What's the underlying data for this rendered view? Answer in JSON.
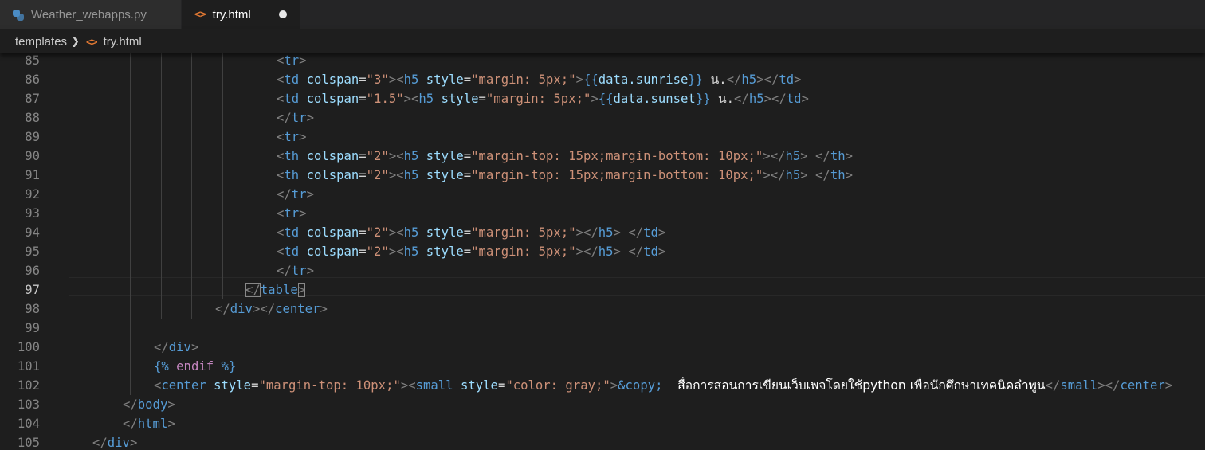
{
  "tabs": [
    {
      "label": "Weather_webapps.py",
      "icon": "python-file-icon",
      "active": false
    },
    {
      "label": "try.html",
      "icon": "html-file-icon",
      "active": true,
      "unsaved": true
    }
  ],
  "breadcrumb": {
    "folder": "templates",
    "separator_icon": "chevron-right-icon",
    "file": "try.html"
  },
  "editor": {
    "colors": {
      "background": "#1e1e1e",
      "tag": "#569cd6",
      "punctuation": "#808080",
      "attribute": "#9cdcfe",
      "string": "#ce9178",
      "template": "#c586c0",
      "text": "#d4d4d4"
    },
    "cursor_line": "97",
    "lines": [
      {
        "num": "85",
        "indent": 7,
        "tokens": [
          [
            "pun",
            "<"
          ],
          [
            "tag",
            "tr"
          ],
          [
            "pun",
            ">"
          ]
        ]
      },
      {
        "num": "86",
        "indent": 7,
        "tokens": [
          [
            "pun",
            "<"
          ],
          [
            "tag",
            "td"
          ],
          [
            "plain",
            " "
          ],
          [
            "attr",
            "colspan"
          ],
          [
            "plain",
            "="
          ],
          [
            "str",
            "\"3\""
          ],
          [
            "pun",
            ">"
          ],
          [
            "pun",
            "<"
          ],
          [
            "tag",
            "h5"
          ],
          [
            "plain",
            " "
          ],
          [
            "attr",
            "style"
          ],
          [
            "plain",
            "="
          ],
          [
            "str",
            "\"margin: 5px;\""
          ],
          [
            "pun",
            ">"
          ],
          [
            "tag",
            "{{"
          ],
          [
            "attr",
            "data.sunrise"
          ],
          [
            "tag",
            "}}"
          ],
          [
            "plain",
            " น."
          ],
          [
            "pun",
            "</"
          ],
          [
            "tag",
            "h5"
          ],
          [
            "pun",
            ">"
          ],
          [
            "pun",
            "</"
          ],
          [
            "tag",
            "td"
          ],
          [
            "pun",
            ">"
          ]
        ]
      },
      {
        "num": "87",
        "indent": 7,
        "tokens": [
          [
            "pun",
            "<"
          ],
          [
            "tag",
            "td"
          ],
          [
            "plain",
            " "
          ],
          [
            "attr",
            "colspan"
          ],
          [
            "plain",
            "="
          ],
          [
            "str",
            "\"1.5\""
          ],
          [
            "pun",
            ">"
          ],
          [
            "pun",
            "<"
          ],
          [
            "tag",
            "h5"
          ],
          [
            "plain",
            " "
          ],
          [
            "attr",
            "style"
          ],
          [
            "plain",
            "="
          ],
          [
            "str",
            "\"margin: 5px;\""
          ],
          [
            "pun",
            ">"
          ],
          [
            "tag",
            "{{"
          ],
          [
            "attr",
            "data.sunset"
          ],
          [
            "tag",
            "}}"
          ],
          [
            "plain",
            " น."
          ],
          [
            "pun",
            "</"
          ],
          [
            "tag",
            "h5"
          ],
          [
            "pun",
            ">"
          ],
          [
            "pun",
            "</"
          ],
          [
            "tag",
            "td"
          ],
          [
            "pun",
            ">"
          ]
        ]
      },
      {
        "num": "88",
        "indent": 7,
        "tokens": [
          [
            "pun",
            "</"
          ],
          [
            "tag",
            "tr"
          ],
          [
            "pun",
            ">"
          ]
        ]
      },
      {
        "num": "89",
        "indent": 7,
        "tokens": [
          [
            "pun",
            "<"
          ],
          [
            "tag",
            "tr"
          ],
          [
            "pun",
            ">"
          ]
        ]
      },
      {
        "num": "90",
        "indent": 7,
        "tokens": [
          [
            "pun",
            "<"
          ],
          [
            "tag",
            "th"
          ],
          [
            "plain",
            " "
          ],
          [
            "attr",
            "colspan"
          ],
          [
            "plain",
            "="
          ],
          [
            "str",
            "\"2\""
          ],
          [
            "pun",
            ">"
          ],
          [
            "pun",
            "<"
          ],
          [
            "tag",
            "h5"
          ],
          [
            "plain",
            " "
          ],
          [
            "attr",
            "style"
          ],
          [
            "plain",
            "="
          ],
          [
            "str",
            "\"margin-top: 15px;margin-bottom: 10px;\""
          ],
          [
            "pun",
            ">"
          ],
          [
            "pun",
            "</"
          ],
          [
            "tag",
            "h5"
          ],
          [
            "pun",
            ">"
          ],
          [
            "plain",
            " "
          ],
          [
            "pun",
            "</"
          ],
          [
            "tag",
            "th"
          ],
          [
            "pun",
            ">"
          ]
        ]
      },
      {
        "num": "91",
        "indent": 7,
        "tokens": [
          [
            "pun",
            "<"
          ],
          [
            "tag",
            "th"
          ],
          [
            "plain",
            " "
          ],
          [
            "attr",
            "colspan"
          ],
          [
            "plain",
            "="
          ],
          [
            "str",
            "\"2\""
          ],
          [
            "pun",
            ">"
          ],
          [
            "pun",
            "<"
          ],
          [
            "tag",
            "h5"
          ],
          [
            "plain",
            " "
          ],
          [
            "attr",
            "style"
          ],
          [
            "plain",
            "="
          ],
          [
            "str",
            "\"margin-top: 15px;margin-bottom: 10px;\""
          ],
          [
            "pun",
            ">"
          ],
          [
            "pun",
            "</"
          ],
          [
            "tag",
            "h5"
          ],
          [
            "pun",
            ">"
          ],
          [
            "plain",
            " "
          ],
          [
            "pun",
            "</"
          ],
          [
            "tag",
            "th"
          ],
          [
            "pun",
            ">"
          ]
        ]
      },
      {
        "num": "92",
        "indent": 7,
        "tokens": [
          [
            "pun",
            "</"
          ],
          [
            "tag",
            "tr"
          ],
          [
            "pun",
            ">"
          ]
        ]
      },
      {
        "num": "93",
        "indent": 7,
        "tokens": [
          [
            "pun",
            "<"
          ],
          [
            "tag",
            "tr"
          ],
          [
            "pun",
            ">"
          ]
        ]
      },
      {
        "num": "94",
        "indent": 7,
        "tokens": [
          [
            "pun",
            "<"
          ],
          [
            "tag",
            "td"
          ],
          [
            "plain",
            " "
          ],
          [
            "attr",
            "colspan"
          ],
          [
            "plain",
            "="
          ],
          [
            "str",
            "\"2\""
          ],
          [
            "pun",
            ">"
          ],
          [
            "pun",
            "<"
          ],
          [
            "tag",
            "h5"
          ],
          [
            "plain",
            " "
          ],
          [
            "attr",
            "style"
          ],
          [
            "plain",
            "="
          ],
          [
            "str",
            "\"margin: 5px;\""
          ],
          [
            "pun",
            ">"
          ],
          [
            "pun",
            "</"
          ],
          [
            "tag",
            "h5"
          ],
          [
            "pun",
            ">"
          ],
          [
            "plain",
            " "
          ],
          [
            "pun",
            "</"
          ],
          [
            "tag",
            "td"
          ],
          [
            "pun",
            ">"
          ]
        ]
      },
      {
        "num": "95",
        "indent": 7,
        "tokens": [
          [
            "pun",
            "<"
          ],
          [
            "tag",
            "td"
          ],
          [
            "plain",
            " "
          ],
          [
            "attr",
            "colspan"
          ],
          [
            "plain",
            "="
          ],
          [
            "str",
            "\"2\""
          ],
          [
            "pun",
            ">"
          ],
          [
            "pun",
            "<"
          ],
          [
            "tag",
            "h5"
          ],
          [
            "plain",
            " "
          ],
          [
            "attr",
            "style"
          ],
          [
            "plain",
            "="
          ],
          [
            "str",
            "\"margin: 5px;\""
          ],
          [
            "pun",
            ">"
          ],
          [
            "pun",
            "</"
          ],
          [
            "tag",
            "h5"
          ],
          [
            "pun",
            ">"
          ],
          [
            "plain",
            " "
          ],
          [
            "pun",
            "</"
          ],
          [
            "tag",
            "td"
          ],
          [
            "pun",
            ">"
          ]
        ]
      },
      {
        "num": "96",
        "indent": 7,
        "tokens": [
          [
            "pun",
            "</"
          ],
          [
            "tag",
            "tr"
          ],
          [
            "pun",
            ">"
          ]
        ]
      },
      {
        "num": "97",
        "indent": 6,
        "tokens": [
          [
            "hl",
            "</"
          ],
          [
            "tag",
            "table"
          ],
          [
            "hl",
            ">"
          ]
        ]
      },
      {
        "num": "98",
        "indent": 5,
        "tokens": [
          [
            "pun",
            "</"
          ],
          [
            "tag",
            "div"
          ],
          [
            "pun",
            ">"
          ],
          [
            "pun",
            "</"
          ],
          [
            "tag",
            "center"
          ],
          [
            "pun",
            ">"
          ]
        ]
      },
      {
        "num": "99",
        "indent": 0,
        "tokens": []
      },
      {
        "num": "100",
        "indent": 3,
        "tokens": [
          [
            "pun",
            "</"
          ],
          [
            "tag",
            "div"
          ],
          [
            "pun",
            ">"
          ]
        ]
      },
      {
        "num": "101",
        "indent": 3,
        "tokens": [
          [
            "tag",
            "{% "
          ],
          [
            "tpl",
            "endif"
          ],
          [
            "tag",
            " %}"
          ]
        ]
      },
      {
        "num": "102",
        "indent": 3,
        "tokens": [
          [
            "pun",
            "<"
          ],
          [
            "tag",
            "center"
          ],
          [
            "plain",
            " "
          ],
          [
            "attr",
            "style"
          ],
          [
            "plain",
            "="
          ],
          [
            "str",
            "\"margin-top: 10px;\""
          ],
          [
            "pun",
            ">"
          ],
          [
            "pun",
            "<"
          ],
          [
            "tag",
            "small"
          ],
          [
            "plain",
            " "
          ],
          [
            "attr",
            "style"
          ],
          [
            "plain",
            "="
          ],
          [
            "str",
            "\"color: gray;\""
          ],
          [
            "pun",
            ">"
          ],
          [
            "tag",
            "&copy;"
          ],
          [
            "plain",
            "  "
          ],
          [
            "thai",
            "สื่อการสอนการเขียนเว็บเพจโดยใช้python เพื่อนักศึกษาเทคนิคลำพูน"
          ],
          [
            "pun",
            "</"
          ],
          [
            "tag",
            "small"
          ],
          [
            "pun",
            ">"
          ],
          [
            "pun",
            "</"
          ],
          [
            "tag",
            "center"
          ],
          [
            "pun",
            ">"
          ]
        ]
      },
      {
        "num": "103",
        "indent": 2,
        "tokens": [
          [
            "pun",
            "</"
          ],
          [
            "tag",
            "body"
          ],
          [
            "pun",
            ">"
          ]
        ]
      },
      {
        "num": "104",
        "indent": 2,
        "tokens": [
          [
            "pun",
            "</"
          ],
          [
            "tag",
            "html"
          ],
          [
            "pun",
            ">"
          ]
        ]
      },
      {
        "num": "105",
        "indent": 1,
        "tokens": [
          [
            "pun",
            "</"
          ],
          [
            "tag",
            "div"
          ],
          [
            "pun",
            ">"
          ]
        ]
      }
    ]
  }
}
